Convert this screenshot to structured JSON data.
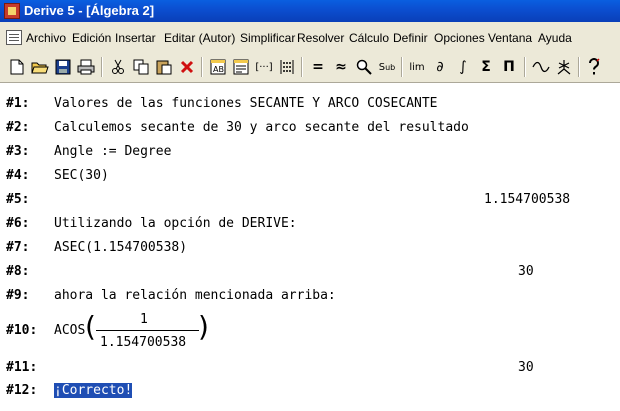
{
  "window": {
    "title": "Derive 5 - [Álgebra 2]"
  },
  "menu": [
    "Archivo",
    "Edición",
    "Insertar",
    "Editar (Autor)",
    "Simplificar",
    "Resolver",
    "Cálculo",
    "Definir",
    "Opciones",
    "Ventana",
    "Ayuda"
  ],
  "toolbar": {
    "icons": [
      "new-file-icon",
      "open-folder-icon",
      "save-icon",
      "print-icon",
      "cut-icon",
      "copy-icon",
      "paste-icon",
      "delete-icon",
      "author-text-icon",
      "author-note-icon",
      "author-vector-icon",
      "author-matrix-icon",
      "simplify-equals-icon",
      "approximate-icon",
      "solve-zoom-icon",
      "substitute-icon",
      "limit-icon",
      "derivative-icon",
      "integral-icon",
      "sum-icon",
      "product-icon",
      "plot-2d-icon",
      "plot-3d-icon",
      "help-icon"
    ],
    "labels": {
      "limit": "lim",
      "derivative": "∂",
      "integral": "∫",
      "sum": "Σ",
      "product": "Π",
      "approximate": "≈",
      "equals": "=",
      "sub": "S",
      "help": "?"
    }
  },
  "lines": [
    {
      "label": "#1:",
      "text": "Valores de las funciones SECANTE Y ARCO COSECANTE"
    },
    {
      "label": "#2:",
      "text": "Calculemos secante de 30 y arco secante del resultado"
    },
    {
      "label": "#3:",
      "text": "Angle := Degree"
    },
    {
      "label": "#4:",
      "text": "SEC(30)"
    },
    {
      "label": "#5:",
      "text": "1.154700538"
    },
    {
      "label": "#6:",
      "text": "Utilizando la opción de DERIVE:"
    },
    {
      "label": "#7:",
      "text": "ASEC(1.154700538)"
    },
    {
      "label": "#8:",
      "text": "30"
    },
    {
      "label": "#9:",
      "text": "ahora la relación mencionada arriba:"
    },
    {
      "label": "#10:",
      "func": "ACOS",
      "numerator": "1",
      "denominator": "1.154700538"
    },
    {
      "label": "#11:",
      "text": "30"
    },
    {
      "label": "#12:",
      "text": "¡Correcto!"
    }
  ],
  "colors": {
    "title_bar": "#0b4fd1",
    "selection": "#1f4eb4"
  }
}
